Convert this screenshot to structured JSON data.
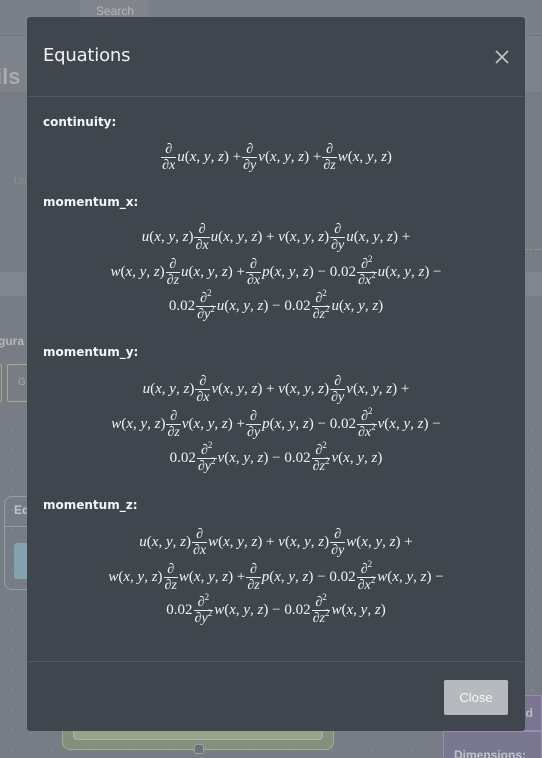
{
  "background": {
    "search_label": "Search",
    "page_title_fragment": "ils",
    "faded_label": "Un",
    "config_label": "gura",
    "config_box_label": "G",
    "node_title": "Eq",
    "purple_node_title": "ond",
    "purple_node_field": "Dimensions:"
  },
  "modal": {
    "title": "Equations",
    "close_icon": "close-x-icon",
    "equations": [
      {
        "label": "continuity:",
        "lines": [
          "∂/∂x u(x, y, z) + ∂/∂y v(x, y, z) + ∂/∂z w(x, y, z)"
        ]
      },
      {
        "label": "momentum_x:",
        "lines": [
          "u(x, y, z) ∂/∂x u(x, y, z) + v(x, y, z) ∂/∂y u(x, y, z) +",
          "w(x, y, z) ∂/∂z u(x, y, z) + ∂/∂x p(x, y, z) − 0.02 ∂²/∂x² u(x, y, z) −",
          "0.02 ∂²/∂y² u(x, y, z) − 0.02 ∂²/∂z² u(x, y, z)"
        ]
      },
      {
        "label": "momentum_y:",
        "lines": [
          "u(x, y, z) ∂/∂x v(x, y, z) + v(x, y, z) ∂/∂y v(x, y, z) +",
          "w(x, y, z) ∂/∂z v(x, y, z) + ∂/∂y p(x, y, z) − 0.02 ∂²/∂x² v(x, y, z) −",
          "0.02 ∂²/∂y² v(x, y, z) − 0.02 ∂²/∂z² v(x, y, z)"
        ]
      },
      {
        "label": "momentum_z:",
        "lines": [
          "u(x, y, z) ∂/∂x w(x, y, z) + v(x, y, z) ∂/∂y w(x, y, z) +",
          "w(x, y, z) ∂/∂z w(x, y, z) + ∂/∂z p(x, y, z) − 0.02 ∂²/∂x² w(x, y, z) −",
          "0.02 ∂²/∂y² w(x, y, z) − 0.02 ∂²/∂z² w(x, y, z)"
        ]
      }
    ],
    "footer": {
      "close_label": "Close"
    }
  },
  "colors": {
    "modal_bg": "#40464e",
    "backdrop": "#787c84",
    "close_button_bg": "#b6b9be",
    "divider": "#525961"
  }
}
